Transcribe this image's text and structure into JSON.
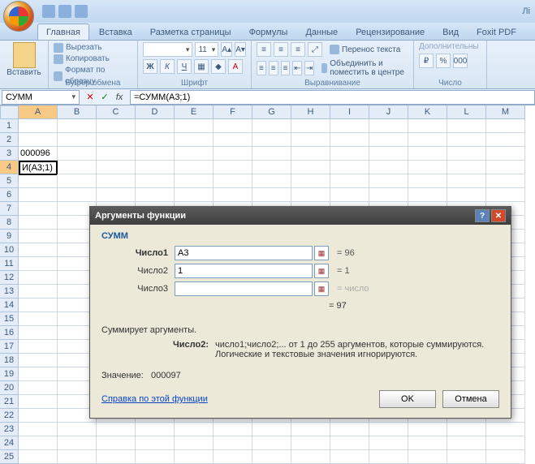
{
  "title_right": "Лі",
  "tabs": {
    "home": "Главная",
    "insert": "Вставка",
    "layout": "Разметка страницы",
    "formulas": "Формулы",
    "data": "Данные",
    "review": "Рецензирование",
    "view": "Вид",
    "foxit": "Foxit PDF"
  },
  "ribbon": {
    "paste": "Вставить",
    "cut": "Вырезать",
    "copy": "Копировать",
    "format_painter": "Формат по образцу",
    "clipboard": "Буфер обмена",
    "font": "Шрифт",
    "align": "Выравнивание",
    "number": "Число",
    "wrap": "Перенос текста",
    "merge": "Объединить и поместить в центре",
    "extra": "Дополнительны",
    "font_size": "11"
  },
  "formula_bar": {
    "name": "СУММ",
    "fx": "fx",
    "formula": "=СУММ(A3;1)"
  },
  "columns": [
    "A",
    "B",
    "C",
    "D",
    "E",
    "F",
    "G",
    "H",
    "I",
    "J",
    "K",
    "L",
    "M"
  ],
  "cells": {
    "A3": "000096",
    "A4": "И(A3;1)"
  },
  "dialog": {
    "title": "Аргументы функции",
    "func": "СУММ",
    "args": [
      {
        "label": "Число1",
        "value": "A3",
        "result": "= 96",
        "bold": true
      },
      {
        "label": "Число2",
        "value": "1",
        "result": "= 1",
        "bold": false
      },
      {
        "label": "Число3",
        "value": "",
        "result": "= число",
        "bold": false
      }
    ],
    "total": "= 97",
    "summary": "Суммирует аргументы.",
    "desc_label": "Число2:",
    "desc_text": "число1;число2;... от 1 до 255 аргументов, которые суммируются. Логические и текстовые значения игнорируются.",
    "value_label": "Значение:",
    "value": "000097",
    "help": "Справка по этой функции",
    "ok": "OK",
    "cancel": "Отмена"
  }
}
